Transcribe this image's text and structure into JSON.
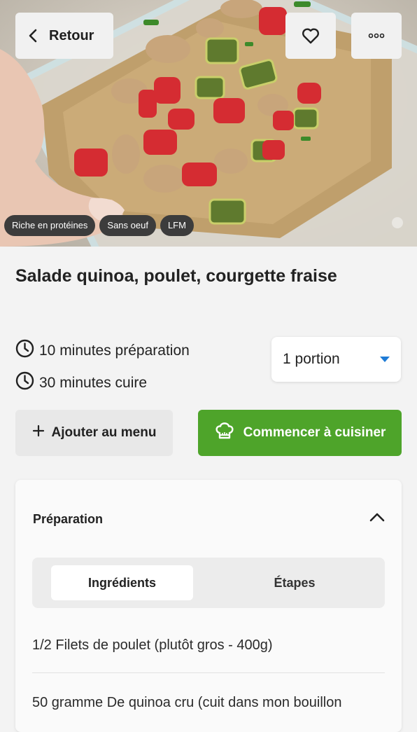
{
  "header": {
    "back_label": "Retour"
  },
  "tags": [
    "Riche en protéines",
    "Sans oeuf",
    "LFM"
  ],
  "recipe": {
    "title": "Salade quinoa, poulet, courgette fraise",
    "prep_time": "10 minutes préparation",
    "cook_time": "30 minutes cuire",
    "portion_selected": "1 portion"
  },
  "actions": {
    "add_menu": "Ajouter au menu",
    "start_cooking": "Commencer à cuisiner"
  },
  "preparation": {
    "heading": "Préparation",
    "tabs": [
      "Ingrédients",
      "Étapes"
    ],
    "ingredients": [
      "1/2 Filets de poulet (plutôt gros - 400g)",
      "50 gramme De quinoa cru (cuit dans mon bouillon"
    ]
  },
  "colors": {
    "accent_green": "#4ea42a",
    "dropdown_caret": "#1e7bd6",
    "tag_bg": "#3c3c3c"
  }
}
